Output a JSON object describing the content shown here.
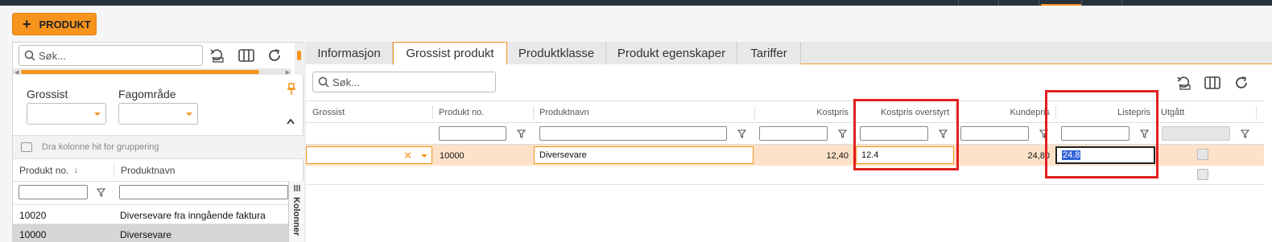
{
  "toolbar": {
    "add_label": "PRODUKT",
    "add_icon": "plus-icon"
  },
  "left_panel": {
    "search_placeholder": "Søk...",
    "filters": [
      {
        "label": "Grossist"
      },
      {
        "label": "Fagområde"
      }
    ],
    "group_hint": "Dra kolonne hit for gruppering",
    "columns": [
      {
        "label": "Produkt no.",
        "sort": "desc"
      },
      {
        "label": "Produktnavn"
      }
    ],
    "rows": [
      {
        "no": "10020",
        "name": "Diversevare fra inngående faktura",
        "selected": false
      },
      {
        "no": "10000",
        "name": "Diversevare",
        "selected": true
      }
    ],
    "columns_panel_label": "Kolonner"
  },
  "right_panel": {
    "tabs": [
      {
        "label": "Informasjon",
        "active": false
      },
      {
        "label": "Grossist produkt",
        "active": true
      },
      {
        "label": "Produktklasse",
        "active": false
      },
      {
        "label": "Produkt egenskaper",
        "active": false
      },
      {
        "label": "Tariffer",
        "active": false
      }
    ],
    "search_placeholder": "Søk...",
    "columns": [
      {
        "label": "Grossist"
      },
      {
        "label": "Produkt no."
      },
      {
        "label": "Produktnavn"
      },
      {
        "label": "Kostpris"
      },
      {
        "label": "Kostpris overstyrt"
      },
      {
        "label": "Kundepris"
      },
      {
        "label": "Listepris"
      },
      {
        "label": "Utgått"
      }
    ],
    "rows": [
      {
        "grossist": "",
        "produkt_no": "10000",
        "produktnavn": "Diversevare",
        "kostpris": "12,40",
        "kostpris_overstyrt": "12.4",
        "kundepris": "24,80",
        "listepris": "24.8"
      }
    ]
  },
  "colors": {
    "accent": "#f7941d",
    "selected_row": "#fde1c8",
    "highlight_box": "#e02020",
    "topbar": "#26313c"
  }
}
